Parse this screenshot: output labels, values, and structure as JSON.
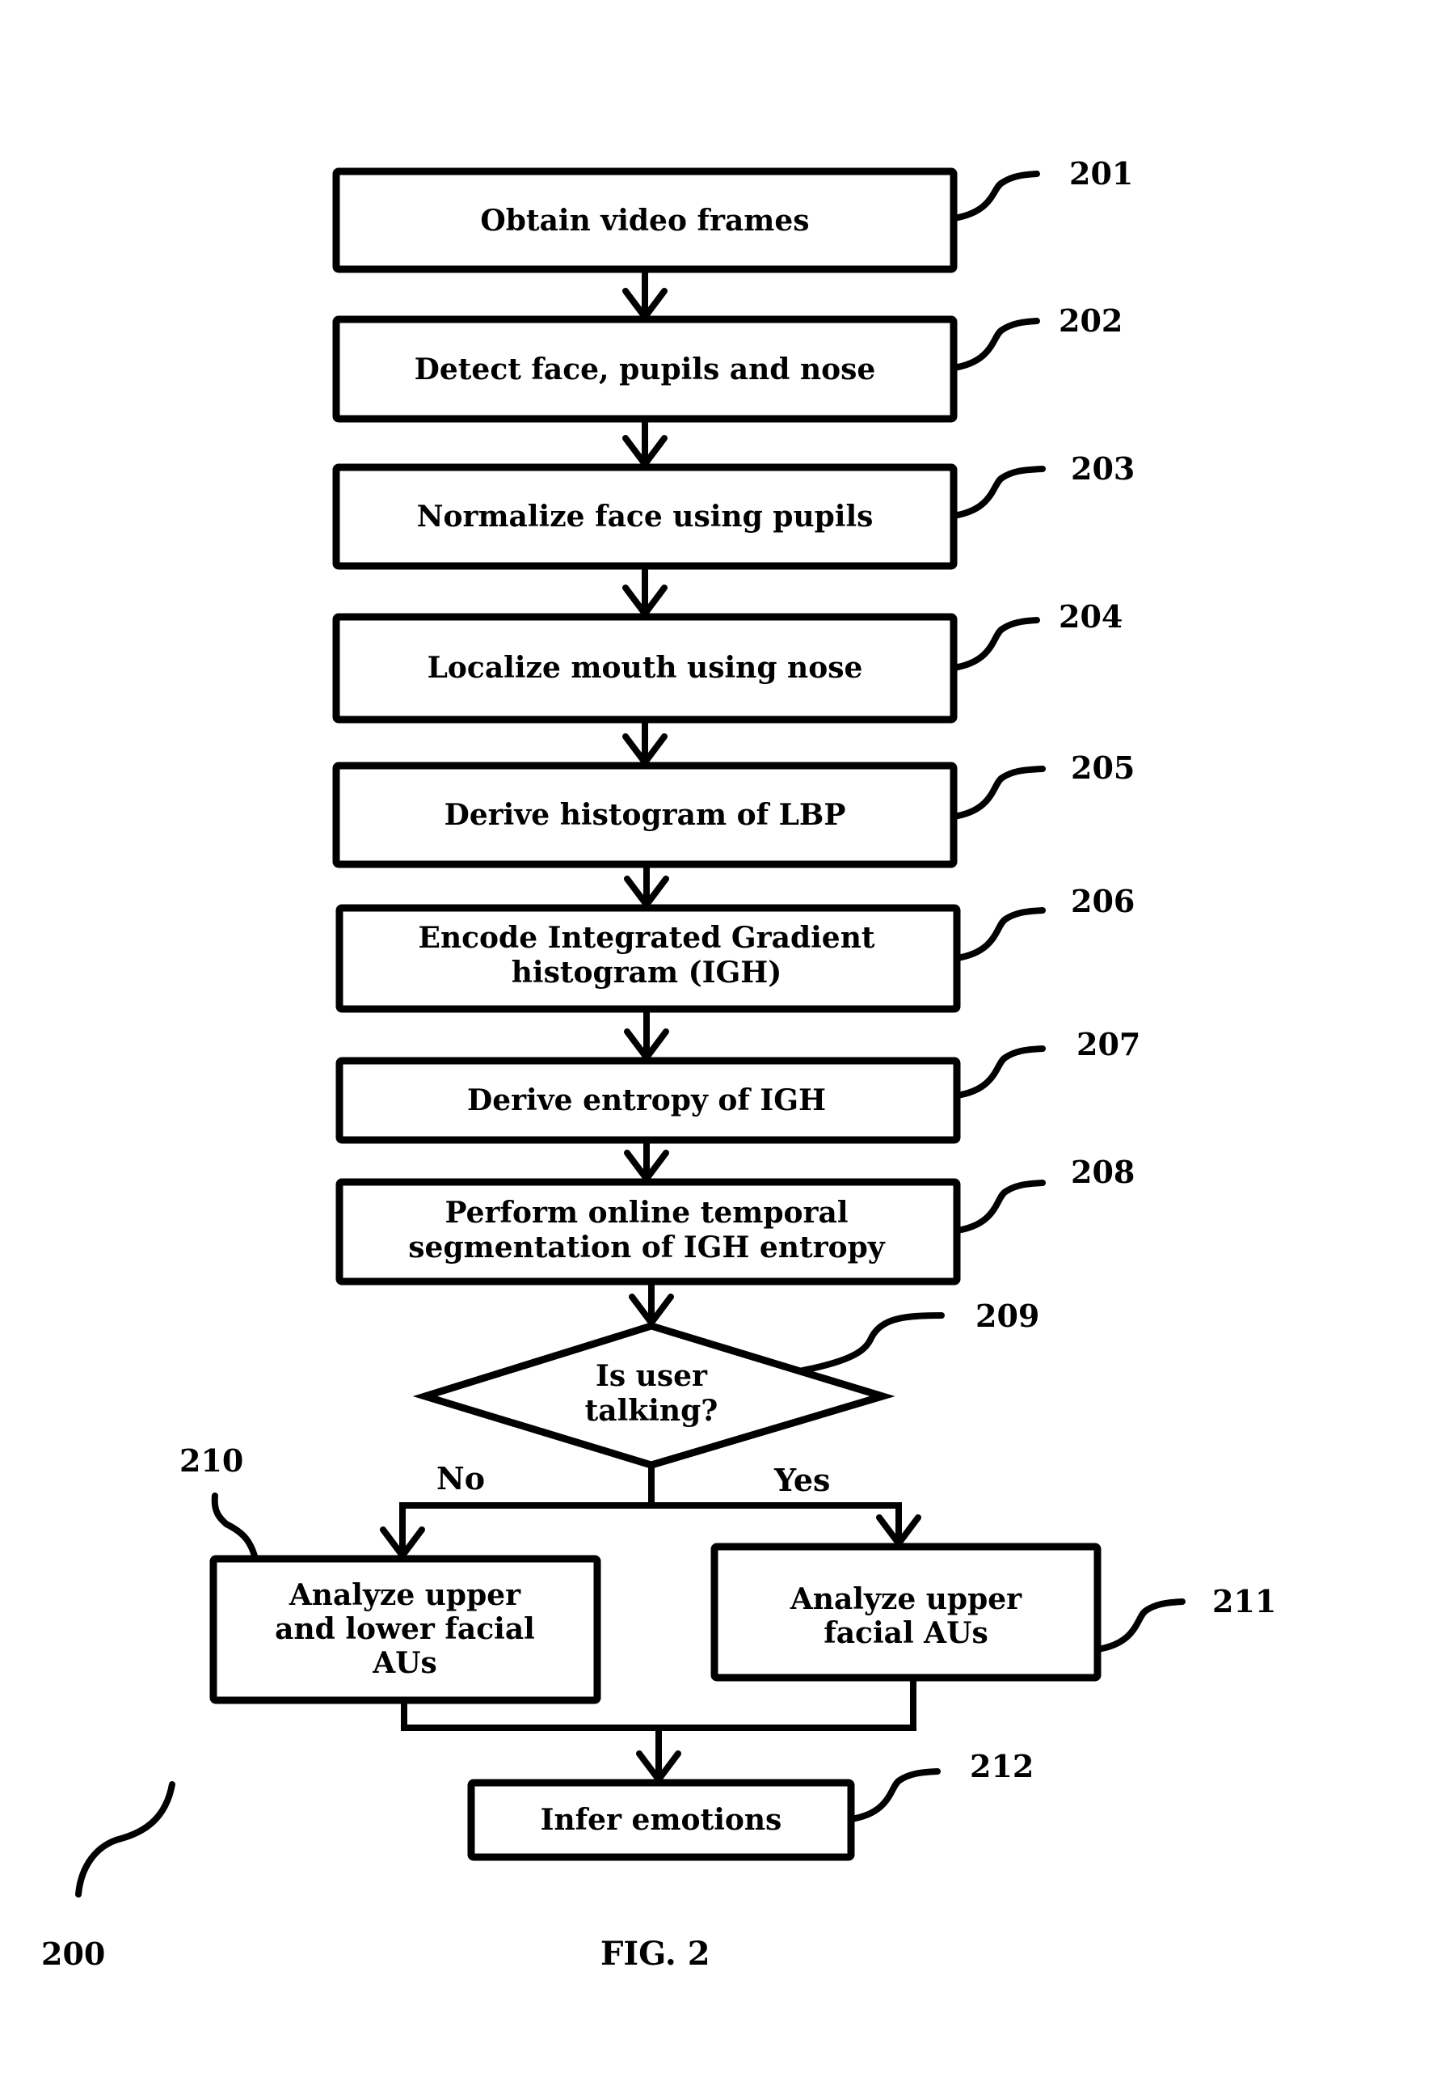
{
  "figure": {
    "caption": "FIG. 2",
    "reference_number": "200"
  },
  "steps": [
    {
      "ref": "201",
      "type": "process",
      "lines": [
        "Obtain video frames"
      ]
    },
    {
      "ref": "202",
      "type": "process",
      "lines": [
        "Detect face, pupils and nose"
      ]
    },
    {
      "ref": "203",
      "type": "process",
      "lines": [
        "Normalize face using pupils"
      ]
    },
    {
      "ref": "204",
      "type": "process",
      "lines": [
        "Localize mouth using nose"
      ]
    },
    {
      "ref": "205",
      "type": "process",
      "lines": [
        "Derive histogram of LBP"
      ]
    },
    {
      "ref": "206",
      "type": "process",
      "lines": [
        "Encode Integrated Gradient",
        "histogram (IGH)"
      ]
    },
    {
      "ref": "207",
      "type": "process",
      "lines": [
        "Derive entropy of IGH"
      ]
    },
    {
      "ref": "208",
      "type": "process",
      "lines": [
        "Perform online temporal",
        "segmentation of IGH entropy"
      ]
    },
    {
      "ref": "209",
      "type": "decision",
      "lines": [
        "Is user",
        "talking?"
      ]
    },
    {
      "ref": "210",
      "type": "process",
      "lines": [
        "Analyze upper",
        "and lower facial",
        "AUs"
      ]
    },
    {
      "ref": "211",
      "type": "process",
      "lines": [
        "Analyze upper",
        "facial AUs"
      ]
    },
    {
      "ref": "212",
      "type": "process",
      "lines": [
        "Infer emotions"
      ]
    }
  ],
  "branches": {
    "no_label": "No",
    "yes_label": "Yes",
    "no_target": "210",
    "yes_target": "211"
  },
  "flow": [
    [
      "201",
      "202"
    ],
    [
      "202",
      "203"
    ],
    [
      "203",
      "204"
    ],
    [
      "204",
      "205"
    ],
    [
      "205",
      "206"
    ],
    [
      "206",
      "207"
    ],
    [
      "207",
      "208"
    ],
    [
      "208",
      "209"
    ],
    [
      "209",
      "210"
    ],
    [
      "209",
      "211"
    ],
    [
      "210",
      "212"
    ],
    [
      "211",
      "212"
    ]
  ],
  "colors": {
    "stroke": "#000000",
    "background": "#ffffff"
  }
}
